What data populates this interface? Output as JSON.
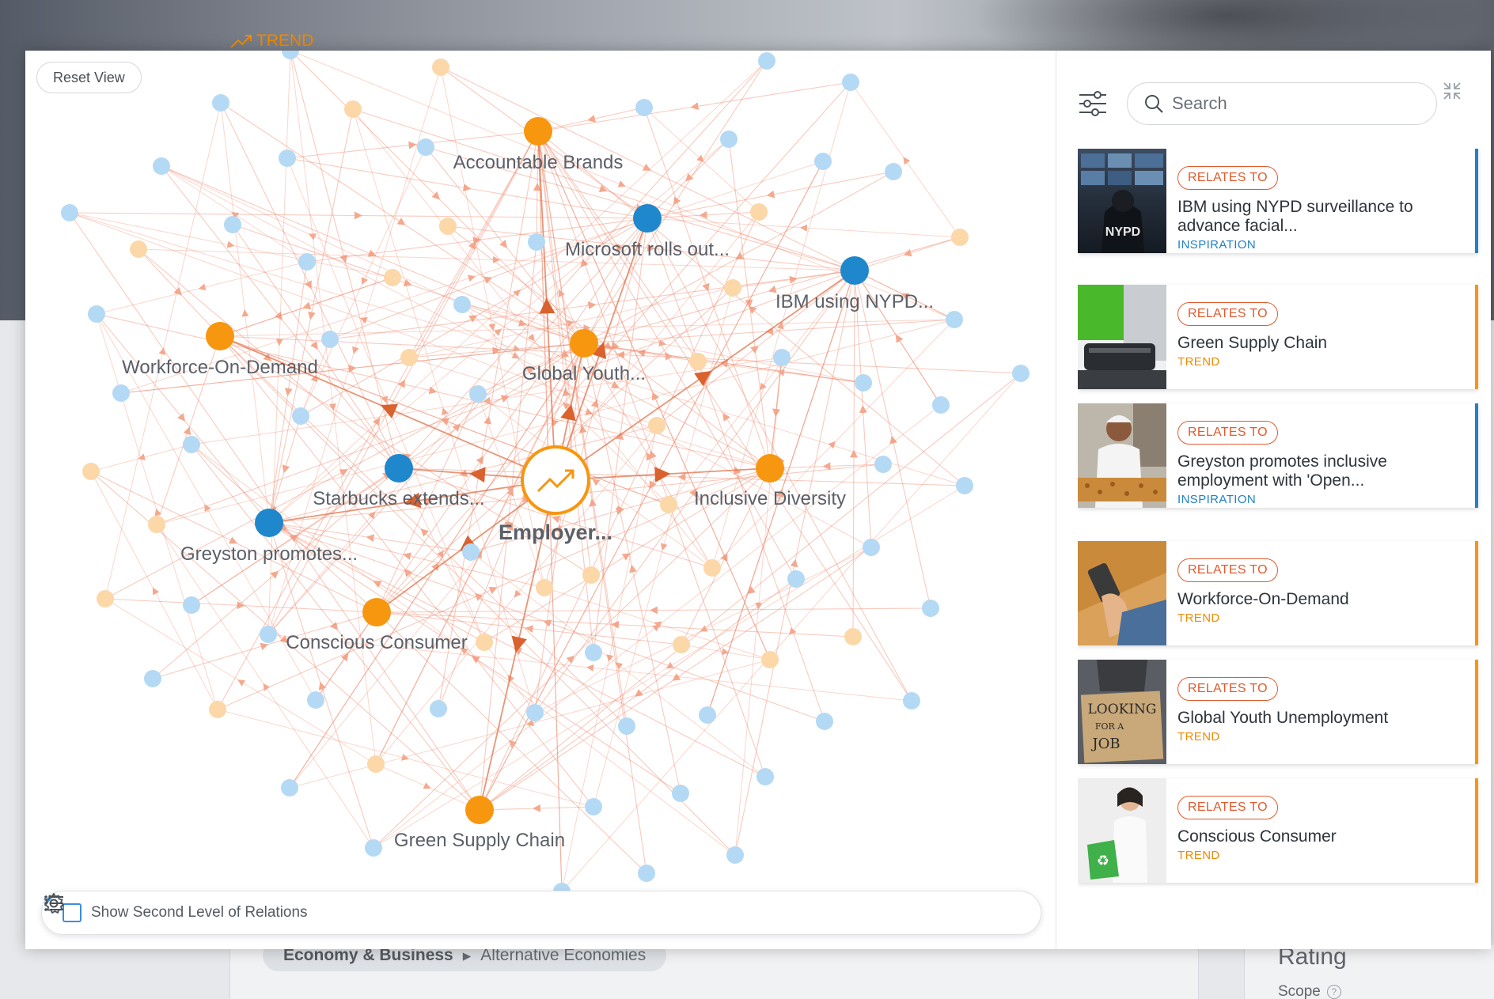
{
  "background": {
    "trend_label": "TREND",
    "breadcrumb": [
      "Economy & Business",
      "Alternative Economies"
    ],
    "rating_label": "Rating",
    "scope_label": "Scope"
  },
  "graph": {
    "reset_label": "Reset View",
    "center_label": "Employer...",
    "labels": {
      "accountable_brands": "Accountable Brands",
      "microsoft": "Microsoft rolls out...",
      "ibm": "IBM using NYPD...",
      "workforce": "Workforce-On-Demand",
      "global_youth": "Global Youth...",
      "starbucks": "Starbucks extends...",
      "inclusive": "Inclusive Diversity",
      "greyston": "Greyston promotes...",
      "conscious": "Conscious Consumer",
      "green_supply": "Green Supply Chain"
    },
    "colors": {
      "trend": "#f7960f",
      "inspiration": "#1f87cb",
      "trend_faded": "#fcd7a8",
      "inspiration_faded": "#b4d9f4",
      "edge": "#f08a6e"
    }
  },
  "bottom_bar": {
    "checkbox_label": "Show Second Level of Relations",
    "checked": true
  },
  "panel": {
    "search_placeholder": "Search",
    "items": [
      {
        "badge": "RELATES TO",
        "title": "IBM using NYPD surveillance to advance facial...",
        "type": "INSPIRATION",
        "accent": "#2281c8"
      },
      {
        "badge": "RELATES TO",
        "title": "Green Supply Chain",
        "type": "TREND",
        "accent": "#f7960f"
      },
      {
        "badge": "RELATES TO",
        "title": "Greyston promotes inclusive employment with 'Open...",
        "type": "INSPIRATION",
        "accent": "#2281c8"
      },
      {
        "badge": "RELATES TO",
        "title": "Workforce-On-Demand",
        "type": "TREND",
        "accent": "#f7960f"
      },
      {
        "badge": "RELATES TO",
        "title": "Global Youth Unemployment",
        "type": "TREND",
        "accent": "#f7960f"
      },
      {
        "badge": "RELATES TO",
        "title": "Conscious Consumer",
        "type": "TREND",
        "accent": "#f7960f"
      }
    ]
  }
}
